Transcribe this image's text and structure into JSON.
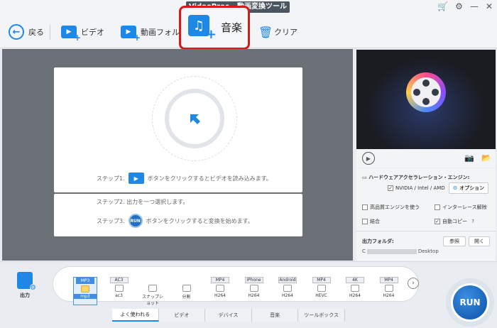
{
  "window": {
    "title": "VideoProc - 動画変換ツール"
  },
  "toolbar": {
    "back": "戻る",
    "video": "ビデオ",
    "video_folder": "動画フォルダ",
    "music": "音楽",
    "clear": "クリア"
  },
  "steps": {
    "step1_prefix": "ステップ1.",
    "step1_text": "ボタンをクリックするとビデオを読み込みます。",
    "step2": "ステップ2. 出力を一つ選択します。",
    "step3_prefix": "ステップ3.",
    "step3_text": "ボタンをクリックすると変換を始めます。",
    "run_mini": "RUN"
  },
  "settings": {
    "hw_accel_label": "ハードウェアアクセラレーション・エンジン:",
    "hw_option": "NVIDIA / Intel / AMD",
    "option_button": "オプション",
    "high_quality": "高品質エンジンを使う",
    "deinterlace": "インターレース解除",
    "merge": "結合",
    "auto_copy": "自動コピー",
    "help": "?",
    "output_folder_label": "出力フォルダ:",
    "browse": "参照",
    "open": "開く",
    "output_path_prefix": "C",
    "output_path_suffix": "Desktop"
  },
  "output": {
    "label": "出力"
  },
  "formats": [
    {
      "tag": "MP3",
      "sub": "mp3",
      "selected": true
    },
    {
      "tag": "AC3",
      "sub": "ac3",
      "selected": false
    },
    {
      "tag": "",
      "sub": "スナップショット",
      "selected": false
    },
    {
      "tag": "",
      "sub": "分割",
      "selected": false
    },
    {
      "tag": "MP4",
      "sub": "H264",
      "selected": false
    },
    {
      "tag": "iPhone",
      "sub": "H264",
      "selected": false
    },
    {
      "tag": "Android",
      "sub": "H264",
      "selected": false
    },
    {
      "tag": "MP4",
      "sub": "HEVC",
      "selected": false
    },
    {
      "tag": "4K",
      "sub": "H264",
      "selected": false
    },
    {
      "tag": "MP4",
      "sub": "H264",
      "selected": false
    }
  ],
  "tabs": [
    "よく使われる",
    "ビデオ",
    "デバイス",
    "音楽",
    "ツールボックス"
  ],
  "run_button": "RUN",
  "colors": {
    "accent": "#1f87e5",
    "highlight_border": "#d61a1a",
    "stage_bg": "#6b6f76"
  }
}
